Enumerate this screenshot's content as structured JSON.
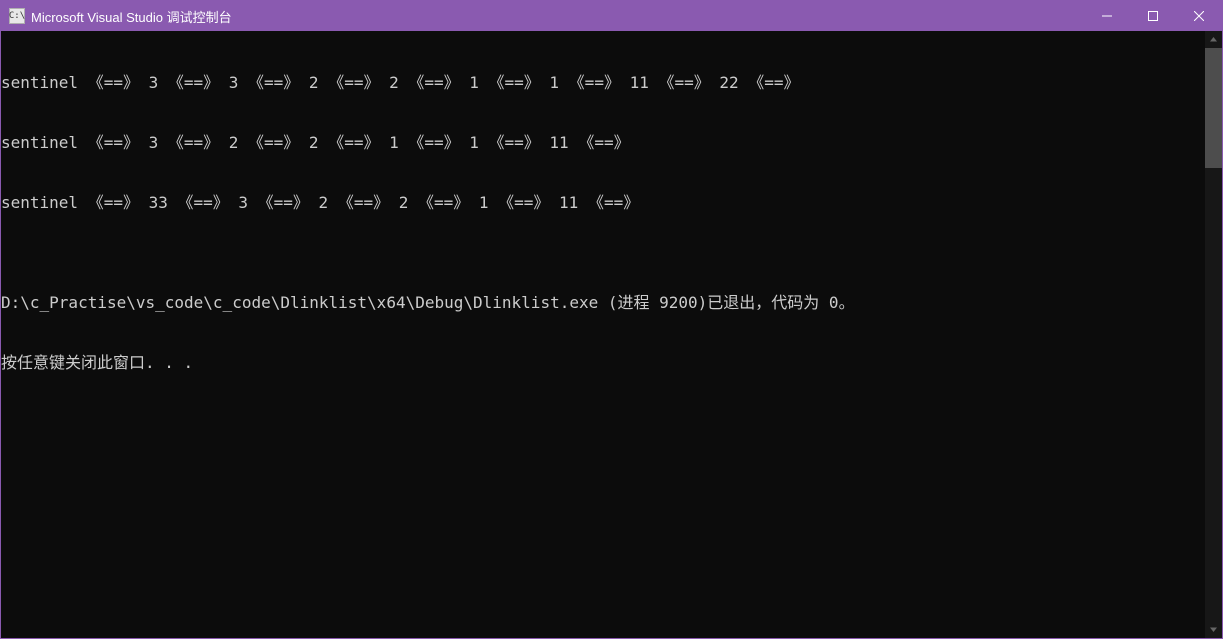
{
  "titlebar": {
    "icon_text": "C:\\",
    "title": "Microsoft Visual Studio 调试控制台"
  },
  "console": {
    "lines": [
      "sentinel 《==》 3 《==》 3 《==》 2 《==》 2 《==》 1 《==》 1 《==》 11 《==》 22 《==》",
      "sentinel 《==》 3 《==》 2 《==》 2 《==》 1 《==》 1 《==》 11 《==》",
      "sentinel 《==》 33 《==》 3 《==》 2 《==》 2 《==》 1 《==》 11 《==》",
      "",
      "D:\\c_Practise\\vs_code\\c_code\\Dlinklist\\x64\\Debug\\Dlinklist.exe (进程 9200)已退出，代码为 0。",
      "按任意键关闭此窗口. . ."
    ]
  }
}
